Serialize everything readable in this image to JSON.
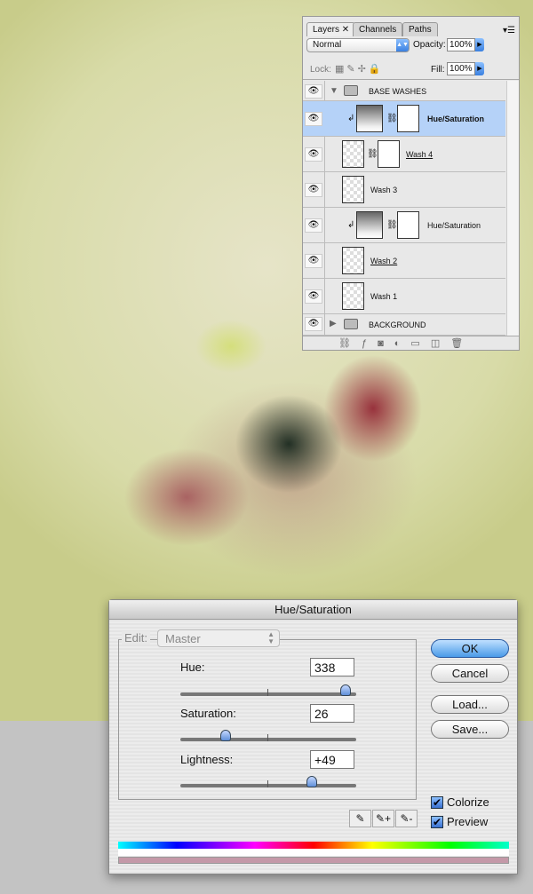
{
  "layers_panel": {
    "tabs": [
      "Layers",
      "Channels",
      "Paths"
    ],
    "blend_mode": "Normal",
    "opacity_label": "Opacity:",
    "opacity": "100%",
    "lock_label": "Lock:",
    "fill_label": "Fill:",
    "fill": "100%",
    "layers": [
      {
        "name": "BASE WASHES",
        "type": "group",
        "expanded": true
      },
      {
        "name": "Hue/Saturation",
        "type": "adjustment",
        "selected": true
      },
      {
        "name": "Wash 4",
        "type": "layer-mask"
      },
      {
        "name": "Wash 3",
        "type": "layer"
      },
      {
        "name": "Hue/Saturation",
        "type": "adjustment"
      },
      {
        "name": "Wash 2",
        "type": "layer"
      },
      {
        "name": "Wash 1",
        "type": "layer"
      },
      {
        "name": "BACKGROUND",
        "type": "group",
        "expanded": false
      }
    ]
  },
  "dialog": {
    "title": "Hue/Saturation",
    "edit_label": "Edit:",
    "edit_value": "Master",
    "hue_label": "Hue:",
    "hue": "338",
    "hue_fraction": 0.939,
    "saturation_label": "Saturation:",
    "saturation": "26",
    "saturation_fraction": 0.26,
    "lightness_label": "Lightness:",
    "lightness": "+49",
    "lightness_fraction": 0.745,
    "ok": "OK",
    "cancel": "Cancel",
    "load": "Load...",
    "save": "Save...",
    "colorize_label": "Colorize",
    "colorize": true,
    "preview_label": "Preview",
    "preview": true,
    "result_color": "#c499a8"
  }
}
